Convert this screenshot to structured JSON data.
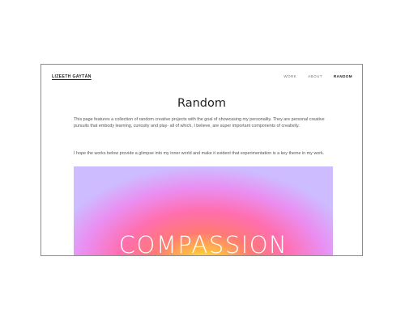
{
  "header": {
    "logo": "LIZEETH GAYTÁN",
    "nav": [
      "WORK",
      "ABOUT",
      "RANDOM"
    ]
  },
  "page": {
    "title": "Random",
    "paragraph1": "This page features a collection of random creative projects with the goal of showcasing my personality. They are personal creative pursuits that embody learning, curiosity and play- all of which, I believe, are super important components of creativity.",
    "paragraph2": "I hope the works below provide a glimpse into my inner world and make it evident that experimentation is a key theme in my work."
  },
  "hero": {
    "word": "COMPASSION"
  }
}
